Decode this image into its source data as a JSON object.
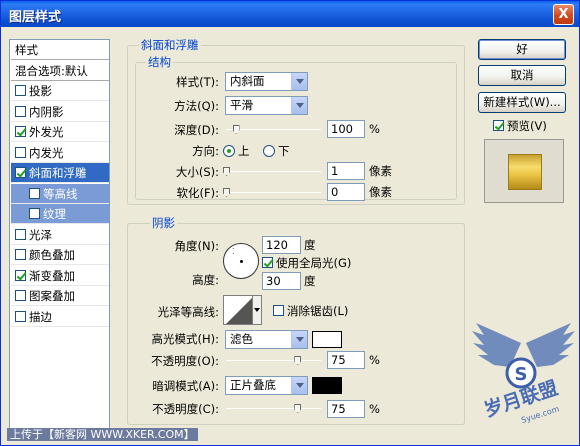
{
  "window": {
    "title": "图层样式",
    "close_glyph": "X"
  },
  "style_list": {
    "items": [
      {
        "label": "样式",
        "kind": "header",
        "checked": null
      },
      {
        "label": "混合选项:默认",
        "kind": "header",
        "checked": null
      },
      {
        "label": "投影",
        "kind": "normal",
        "checked": false
      },
      {
        "label": "内阴影",
        "kind": "normal",
        "checked": false
      },
      {
        "label": "外发光",
        "kind": "normal",
        "checked": true
      },
      {
        "label": "内发光",
        "kind": "normal",
        "checked": false
      },
      {
        "label": "斜面和浮雕",
        "kind": "selected",
        "checked": true
      },
      {
        "label": "等高线",
        "kind": "sub",
        "checked": false
      },
      {
        "label": "纹理",
        "kind": "sub",
        "checked": false
      },
      {
        "label": "光泽",
        "kind": "normal",
        "checked": false
      },
      {
        "label": "颜色叠加",
        "kind": "normal",
        "checked": false
      },
      {
        "label": "渐变叠加",
        "kind": "normal",
        "checked": true
      },
      {
        "label": "图案叠加",
        "kind": "normal",
        "checked": false
      },
      {
        "label": "描边",
        "kind": "normal",
        "checked": false
      }
    ]
  },
  "bevel": {
    "group_title": "斜面和浮雕",
    "structure_title": "结构",
    "style_label": "样式(T):",
    "style_value": "内斜面",
    "technique_label": "方法(Q):",
    "technique_value": "平滑",
    "depth_label": "深度(D):",
    "depth_value": "100",
    "depth_percent": 100,
    "depth_unit": "%",
    "direction_label": "方向:",
    "direction_up": "上",
    "direction_down": "下",
    "direction_selected": "up",
    "size_label": "大小(S):",
    "size_value": "1",
    "size_unit": "像素",
    "soften_label": "软化(F):",
    "soften_value": "0",
    "soften_unit": "像素"
  },
  "shading": {
    "title": "阴影",
    "angle_label": "角度(N):",
    "angle_value": "120",
    "angle_unit": "度",
    "global_light_label": "使用全局光(G)",
    "global_light_checked": true,
    "altitude_label": "高度:",
    "altitude_value": "30",
    "altitude_unit": "度",
    "gloss_contour_label": "光泽等高线:",
    "anti_alias_label": "消除锯齿(L)",
    "anti_alias_checked": false,
    "highlight_mode_label": "高光模式(H):",
    "highlight_mode_value": "滤色",
    "highlight_color": "#FFFFFF",
    "highlight_opacity_label": "不透明度(O):",
    "highlight_opacity_value": "75",
    "highlight_opacity_percent": 75,
    "shadow_mode_label": "暗调模式(A):",
    "shadow_mode_value": "正片叠底",
    "shadow_color": "#000000",
    "shadow_opacity_label": "不透明度(C):",
    "shadow_opacity_value": "75",
    "shadow_opacity_percent": 75,
    "percent_unit": "%"
  },
  "buttons": {
    "ok": "好",
    "cancel": "取消",
    "new_style": "新建样式(W)...",
    "preview_label": "预览(V)",
    "preview_checked": true
  },
  "footer": {
    "text": "上传于【新客网 WWW.XKER.COM】"
  },
  "watermark": {
    "text": "岁月联盟",
    "sub": "Syue.com",
    "badge": "S"
  },
  "colors": {
    "titlebar": "#0A5FE8",
    "selection": "#316AC5",
    "group_label": "#0046D5",
    "dialog_bg": "#ECE9D8"
  }
}
